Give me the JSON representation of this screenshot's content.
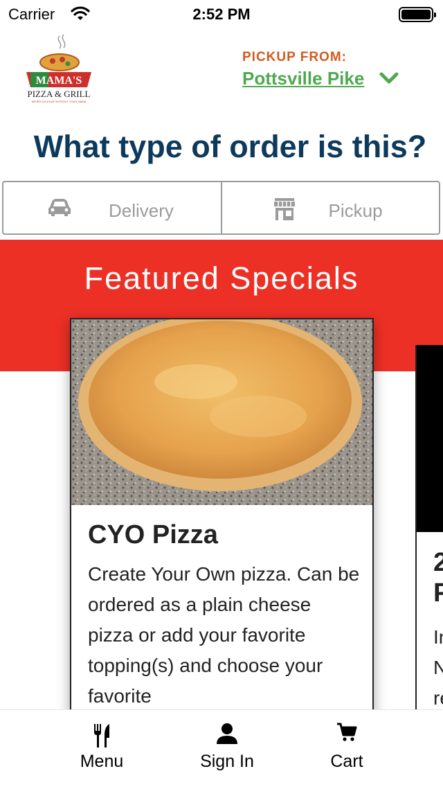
{
  "status_bar": {
    "carrier": "Carrier",
    "time": "2:52 PM",
    "battery_level": 1.0
  },
  "header": {
    "logo": {
      "name": "MAMA'S",
      "sub": "PIZZA & GRILL",
      "tagline": "NEVER GO A DAY WITHOUT YOUR MAMA",
      "icon": "pizza-logo"
    },
    "pickup_label": "PICKUP FROM:",
    "location": "Pottsville Pike",
    "location_icon": "chevron-down-icon"
  },
  "order_type": {
    "question": "What type of order is this?",
    "options": [
      {
        "label": "Delivery",
        "icon": "car-icon"
      },
      {
        "label": "Pickup",
        "icon": "store-icon"
      }
    ]
  },
  "featured": {
    "title": "Featured Specials",
    "cards": [
      {
        "title": "CYO Pizza",
        "description": "Create Your Own pizza. Can be ordered as a plain cheese pizza or add your favorite topping(s) and choose your favorite",
        "image": "cheese-pizza-photo"
      },
      {
        "title_line1": "2",
        "title_line2": "P",
        "desc_line1": "In",
        "desc_line2": "N",
        "desc_line3": "re"
      }
    ]
  },
  "tab_bar": {
    "tabs": [
      {
        "label": "Menu",
        "icon": "fork-knife-icon"
      },
      {
        "label": "Sign In",
        "icon": "user-icon"
      },
      {
        "label": "Cart",
        "icon": "cart-icon"
      }
    ]
  },
  "colors": {
    "accent_red": "#ed3026",
    "navy": "#0d3a5c",
    "green": "#4fa84f",
    "orange": "#d35a1e",
    "muted_gray": "#9b9b9b"
  }
}
